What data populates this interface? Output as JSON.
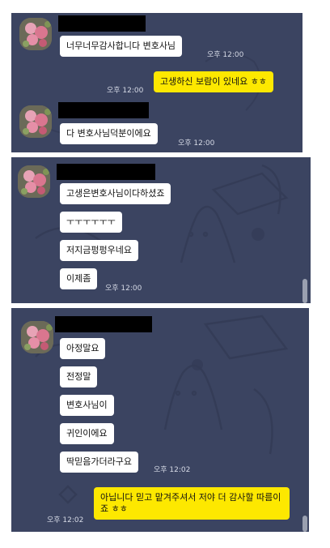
{
  "colors": {
    "chat_background": "#3b4461",
    "incoming_bubble": "#ffffff",
    "outgoing_bubble": "#fde800",
    "timestamp_text": "#d6dae6",
    "redaction": "#000000"
  },
  "screens": [
    {
      "messages": [
        {
          "text": "너무너무감사합니다 변호사님",
          "time": "오후 12:00"
        },
        {
          "text": "고생하신 보람이 있네요 ㅎㅎ",
          "time": "오후 12:00"
        },
        {
          "text": "다 변호사님덕분이에요",
          "time": "오후 12:00"
        }
      ]
    },
    {
      "messages": [
        {
          "text": "고생은변호사님이다하셨죠"
        },
        {
          "text": "ㅜㅜㅜㅜㅜㅜ"
        },
        {
          "text": "저지금펑펑우네요"
        },
        {
          "text": "이제좀",
          "time": "오후 12:00"
        }
      ]
    },
    {
      "messages": [
        {
          "text": "아정말요"
        },
        {
          "text": "전정말"
        },
        {
          "text": "변호사님이"
        },
        {
          "text": "귀인이에요"
        },
        {
          "text": "딱믿음가더라구요",
          "time": "오후 12:02"
        },
        {
          "text": "아닙니다 믿고 맡겨주셔서 저야 더 감사할 따름이죠 ㅎㅎ",
          "time": "오후 12:02"
        }
      ]
    }
  ]
}
